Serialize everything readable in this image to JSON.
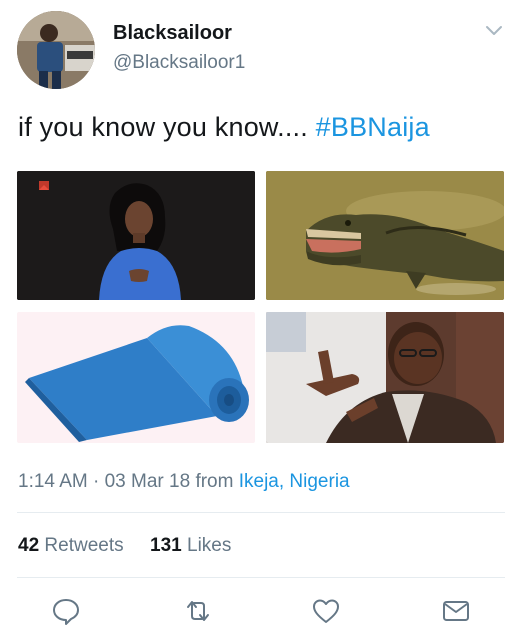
{
  "user": {
    "name": "Blacksailoor",
    "handle": "@Blacksailoor1"
  },
  "tweet": {
    "text": "if you know you know....",
    "hashtag": "#BBNaija"
  },
  "media": [
    {
      "icon": "photo-woman-blue-dress"
    },
    {
      "icon": "photo-crocodile"
    },
    {
      "icon": "photo-blue-yoga-mat"
    },
    {
      "icon": "photo-man-pointing"
    }
  ],
  "meta": {
    "time": "1:14 AM",
    "separator": "·",
    "date": "03 Mar 18",
    "from": "from",
    "location": "Ikeja, Nigeria"
  },
  "stats": {
    "retweets_count": "42",
    "retweets_label": "Retweets",
    "likes_count": "131",
    "likes_label": "Likes"
  },
  "actions": [
    "reply-icon",
    "retweet-icon",
    "like-icon",
    "message-icon"
  ],
  "colors": {
    "link": "#1b95e0",
    "secondary": "#657786",
    "primary_text": "#14171a",
    "divider": "#e6ecf0"
  }
}
